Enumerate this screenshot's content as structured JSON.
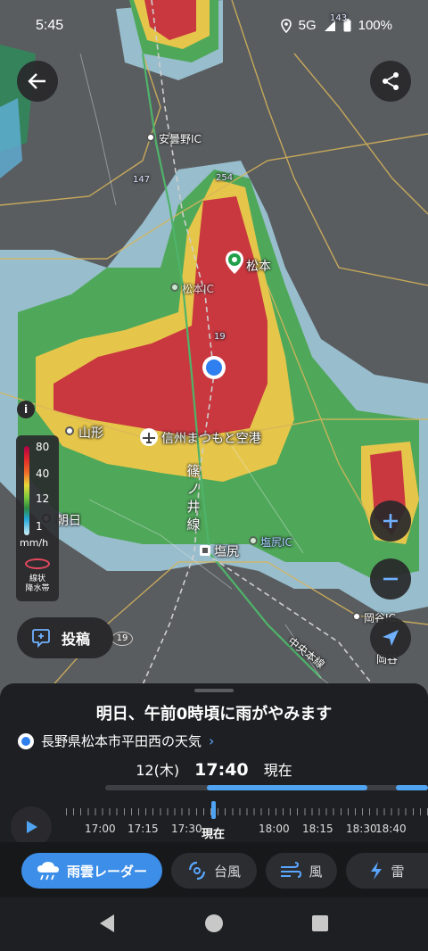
{
  "status_bar": {
    "time": "5:45",
    "network": "5G",
    "battery": "100%"
  },
  "map": {
    "places": {
      "azumino_ic": "安曇野IC",
      "matsumoto": "松本",
      "matsumoto_ic": "松本IC",
      "yamagata": "山形",
      "airport": "信州まつもと空港",
      "shinonoi_line": "篠ノ井線",
      "asahi": "朝日",
      "shiojiri": "塩尻",
      "shiojiri_ic": "塩尻IC",
      "okaya_ic": "岡谷IC",
      "okaya": "岡谷",
      "chuo_line": "中央本線",
      "route_147": "147",
      "route_254": "254",
      "route_19": "19",
      "route_143": "143",
      "route_19b": "19"
    },
    "legend": {
      "ticks": [
        "80",
        "40",
        "12",
        "1"
      ],
      "unit": "mm/h",
      "band_line1": "線状",
      "band_line2": "降水帯"
    },
    "post_label": "投稿"
  },
  "sheet": {
    "headline": "明日、午前0時頃に雨がやみます",
    "location": "長野県松本市平田西の天気",
    "date": "12(木)",
    "current_time": "17:40",
    "current_label": "現在",
    "timeline_labels": [
      "17:00",
      "17:15",
      "17:30",
      "現在",
      "18:00",
      "18:15",
      "18:30",
      "18:40"
    ]
  },
  "tabs": [
    {
      "label": "雨雲レーダー",
      "icon": "rain-cloud-icon"
    },
    {
      "label": "台風",
      "icon": "typhoon-icon"
    },
    {
      "label": "風",
      "icon": "wind-icon"
    },
    {
      "label": "雷",
      "icon": "lightning-icon"
    }
  ],
  "colors": {
    "accent": "#3d8ee9",
    "rain_heavy": "#c9353e",
    "rain_mid": "#e5c24a",
    "rain_light": "#2e9450"
  }
}
